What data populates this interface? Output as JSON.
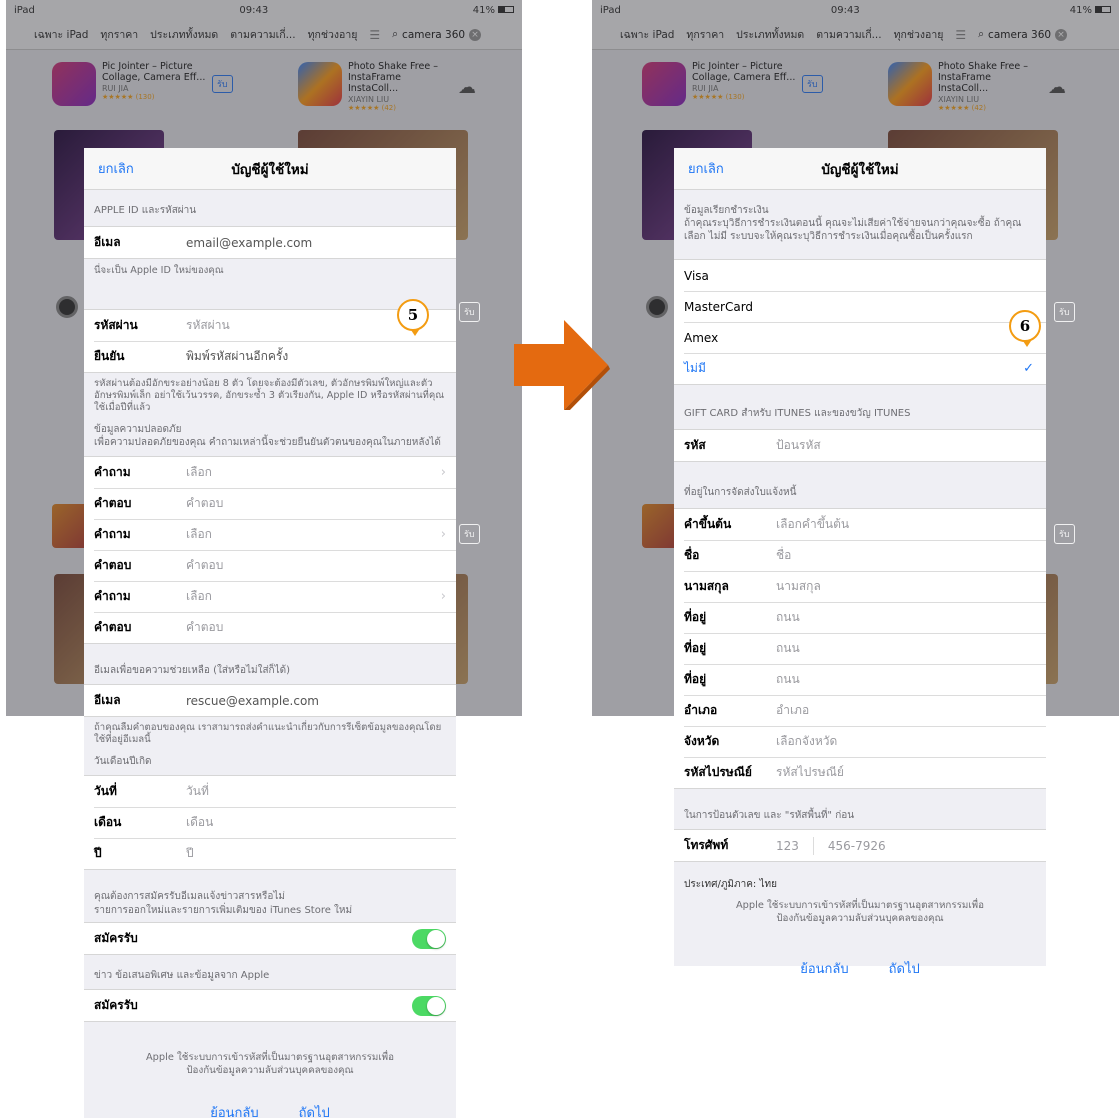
{
  "colors": {
    "accent": "#1f76f4",
    "toggle": "#4cd964",
    "arrow": "#e46a10",
    "step_ring": "#f39c12"
  },
  "ipad": {
    "status_left": "iPad",
    "time": "09:43",
    "battery": "41%",
    "filters": [
      "เฉพาะ iPad",
      "ทุกราคา",
      "ประเภททั้งหมด",
      "ตามความเกี่...",
      "ทุกช่วงอายุ"
    ],
    "search_text": "camera 360",
    "apps": [
      {
        "name": "Pic Jointer – Picture Collage, Camera Eff...",
        "dev": "RUI JIA",
        "rating": "★★★★★ (130)",
        "get": "รับ"
      },
      {
        "name": "Photo Shake Free – InstaFrame InstaColl...",
        "dev": "XIAYIN LIU",
        "rating": "★★★★★ (42)"
      }
    ]
  },
  "left_sheet": {
    "cancel": "ยกเลิก",
    "title": "บัญชีผู้ใช้ใหม่",
    "apple_id_header": "APPLE ID และรหัสผ่าน",
    "email_label": "อีเมล",
    "email_value": "email@example.com",
    "email_note": "นี่จะเป็น Apple ID ใหม่ของคุณ",
    "password_label": "รหัสผ่าน",
    "password_placeholder": "รหัสผ่าน",
    "confirm_label": "ยืนยัน",
    "confirm_placeholder": "พิมพ์รหัสผ่านอีกครั้ง",
    "password_note": "รหัสผ่านต้องมีอักขระอย่างน้อย 8 ตัว โดยจะต้องมีตัวเลข, ตัวอักษรพิมพ์ใหญ่และตัวอักษรพิมพ์เล็ก อย่าใช้เว้นวรรค, อักขระซ้ำ 3 ตัวเรียงกัน, Apple ID หรือรหัสผ่านที่คุณใช้เมื่อปีที่แล้ว",
    "security_header": "ข้อมูลความปลอดภัย",
    "security_sub": "เพื่อความปลอดภัยของคุณ คำถามเหล่านี้จะช่วยยืนยันตัวตนของคุณในภายหลังได้",
    "question_label": "คำถาม",
    "question_value": "เลือก",
    "answer_label": "คำตอบ",
    "answer_value": "คำตอบ",
    "rescue_header": "อีเมลเพื่อขอความช่วยเหลือ (ใส่หรือไม่ใส่ก็ได้)",
    "rescue_label": "อีเมล",
    "rescue_value": "rescue@example.com",
    "rescue_note": "ถ้าคุณลืมคำตอบของคุณ เราสามารถส่งคำแนะนำเกี่ยวกับการรีเซ็ตข้อมูลของคุณโดยใช้ที่อยู่อีเมลนี้",
    "birthday_header": "วันเดือนปีเกิด",
    "day_label": "วันที่",
    "day_value": "วันที่",
    "month_label": "เดือน",
    "month_value": "เดือน",
    "year_label": "ปี",
    "year_value": "ปี",
    "newsletter_q": "คุณต้องการสมัครรับอีเมลแจ้งข่าวสารหรือไม่",
    "newsletter_1": "รายการออกใหม่และรายการเพิ่มเติมของ iTunes Store ใหม่",
    "subscribe_label": "สมัครรับ",
    "newsletter_2": "ข่าว ข้อเสนอพิเศษ และข้อมูลจาก Apple",
    "legal": "Apple ใช้ระบบการเข้ารหัสที่เป็นมาตรฐานอุตสาหกรรมเพื่อป้องกันข้อมูลความลับส่วนบุคคลของคุณ",
    "back": "ย้อนกลับ",
    "next": "ถัดไป",
    "step": "5"
  },
  "right_sheet": {
    "cancel": "ยกเลิก",
    "title": "บัญชีผู้ใช้ใหม่",
    "billing_header": "ข้อมูลเรียกชำระเงิน",
    "billing_note": "ถ้าคุณระบุวิธีการชำระเงินตอนนี้ คุณจะไม่เสียค่าใช้จ่ายจนกว่าคุณจะซื้อ ถ้าคุณเลือก ไม่มี ระบบจะให้คุณระบุวิธีการชำระเงินเมื่อคุณซื้อเป็นครั้งแรก",
    "payments": [
      "Visa",
      "MasterCard",
      "Amex",
      "ไม่มี"
    ],
    "giftcard_header": "GIFT CARD สำหรับ ITUNES และของขวัญ ITUNES",
    "code_label": "รหัส",
    "code_placeholder": "ป้อนรหัส",
    "address_header": "ที่อยู่ในการจัดส่งใบแจ้งหนี้",
    "rows": [
      {
        "label": "คำขึ้นต้น",
        "value": "เลือกคำขึ้นต้น"
      },
      {
        "label": "ชื่อ",
        "value": "ชื่อ"
      },
      {
        "label": "นามสกุล",
        "value": "นามสกุล"
      },
      {
        "label": "ที่อยู่",
        "value": "ถนน"
      },
      {
        "label": "ที่อยู่",
        "value": "ถนน"
      },
      {
        "label": "ที่อยู่",
        "value": "ถนน"
      },
      {
        "label": "อำเภอ",
        "value": "อำเภอ"
      },
      {
        "label": "จังหวัด",
        "value": "เลือกจังหวัด"
      },
      {
        "label": "รหัสไปรษณีย์",
        "value": "รหัสไปรษณีย์"
      }
    ],
    "phone_note": "ในการป้อนตัวเลข และ \"รหัสพื้นที่\" ก่อน",
    "phone_label": "โทรศัพท์",
    "phone_area": "123",
    "phone_number": "456-7926",
    "country": "ประเทศ/ภูมิภาค: ไทย",
    "legal": "Apple ใช้ระบบการเข้ารหัสที่เป็นมาตรฐานอุตสาหกรรมเพื่อป้องกันข้อมูลความลับส่วนบุคคลของคุณ",
    "back": "ย้อนกลับ",
    "next": "ถัดไป",
    "step": "6"
  }
}
